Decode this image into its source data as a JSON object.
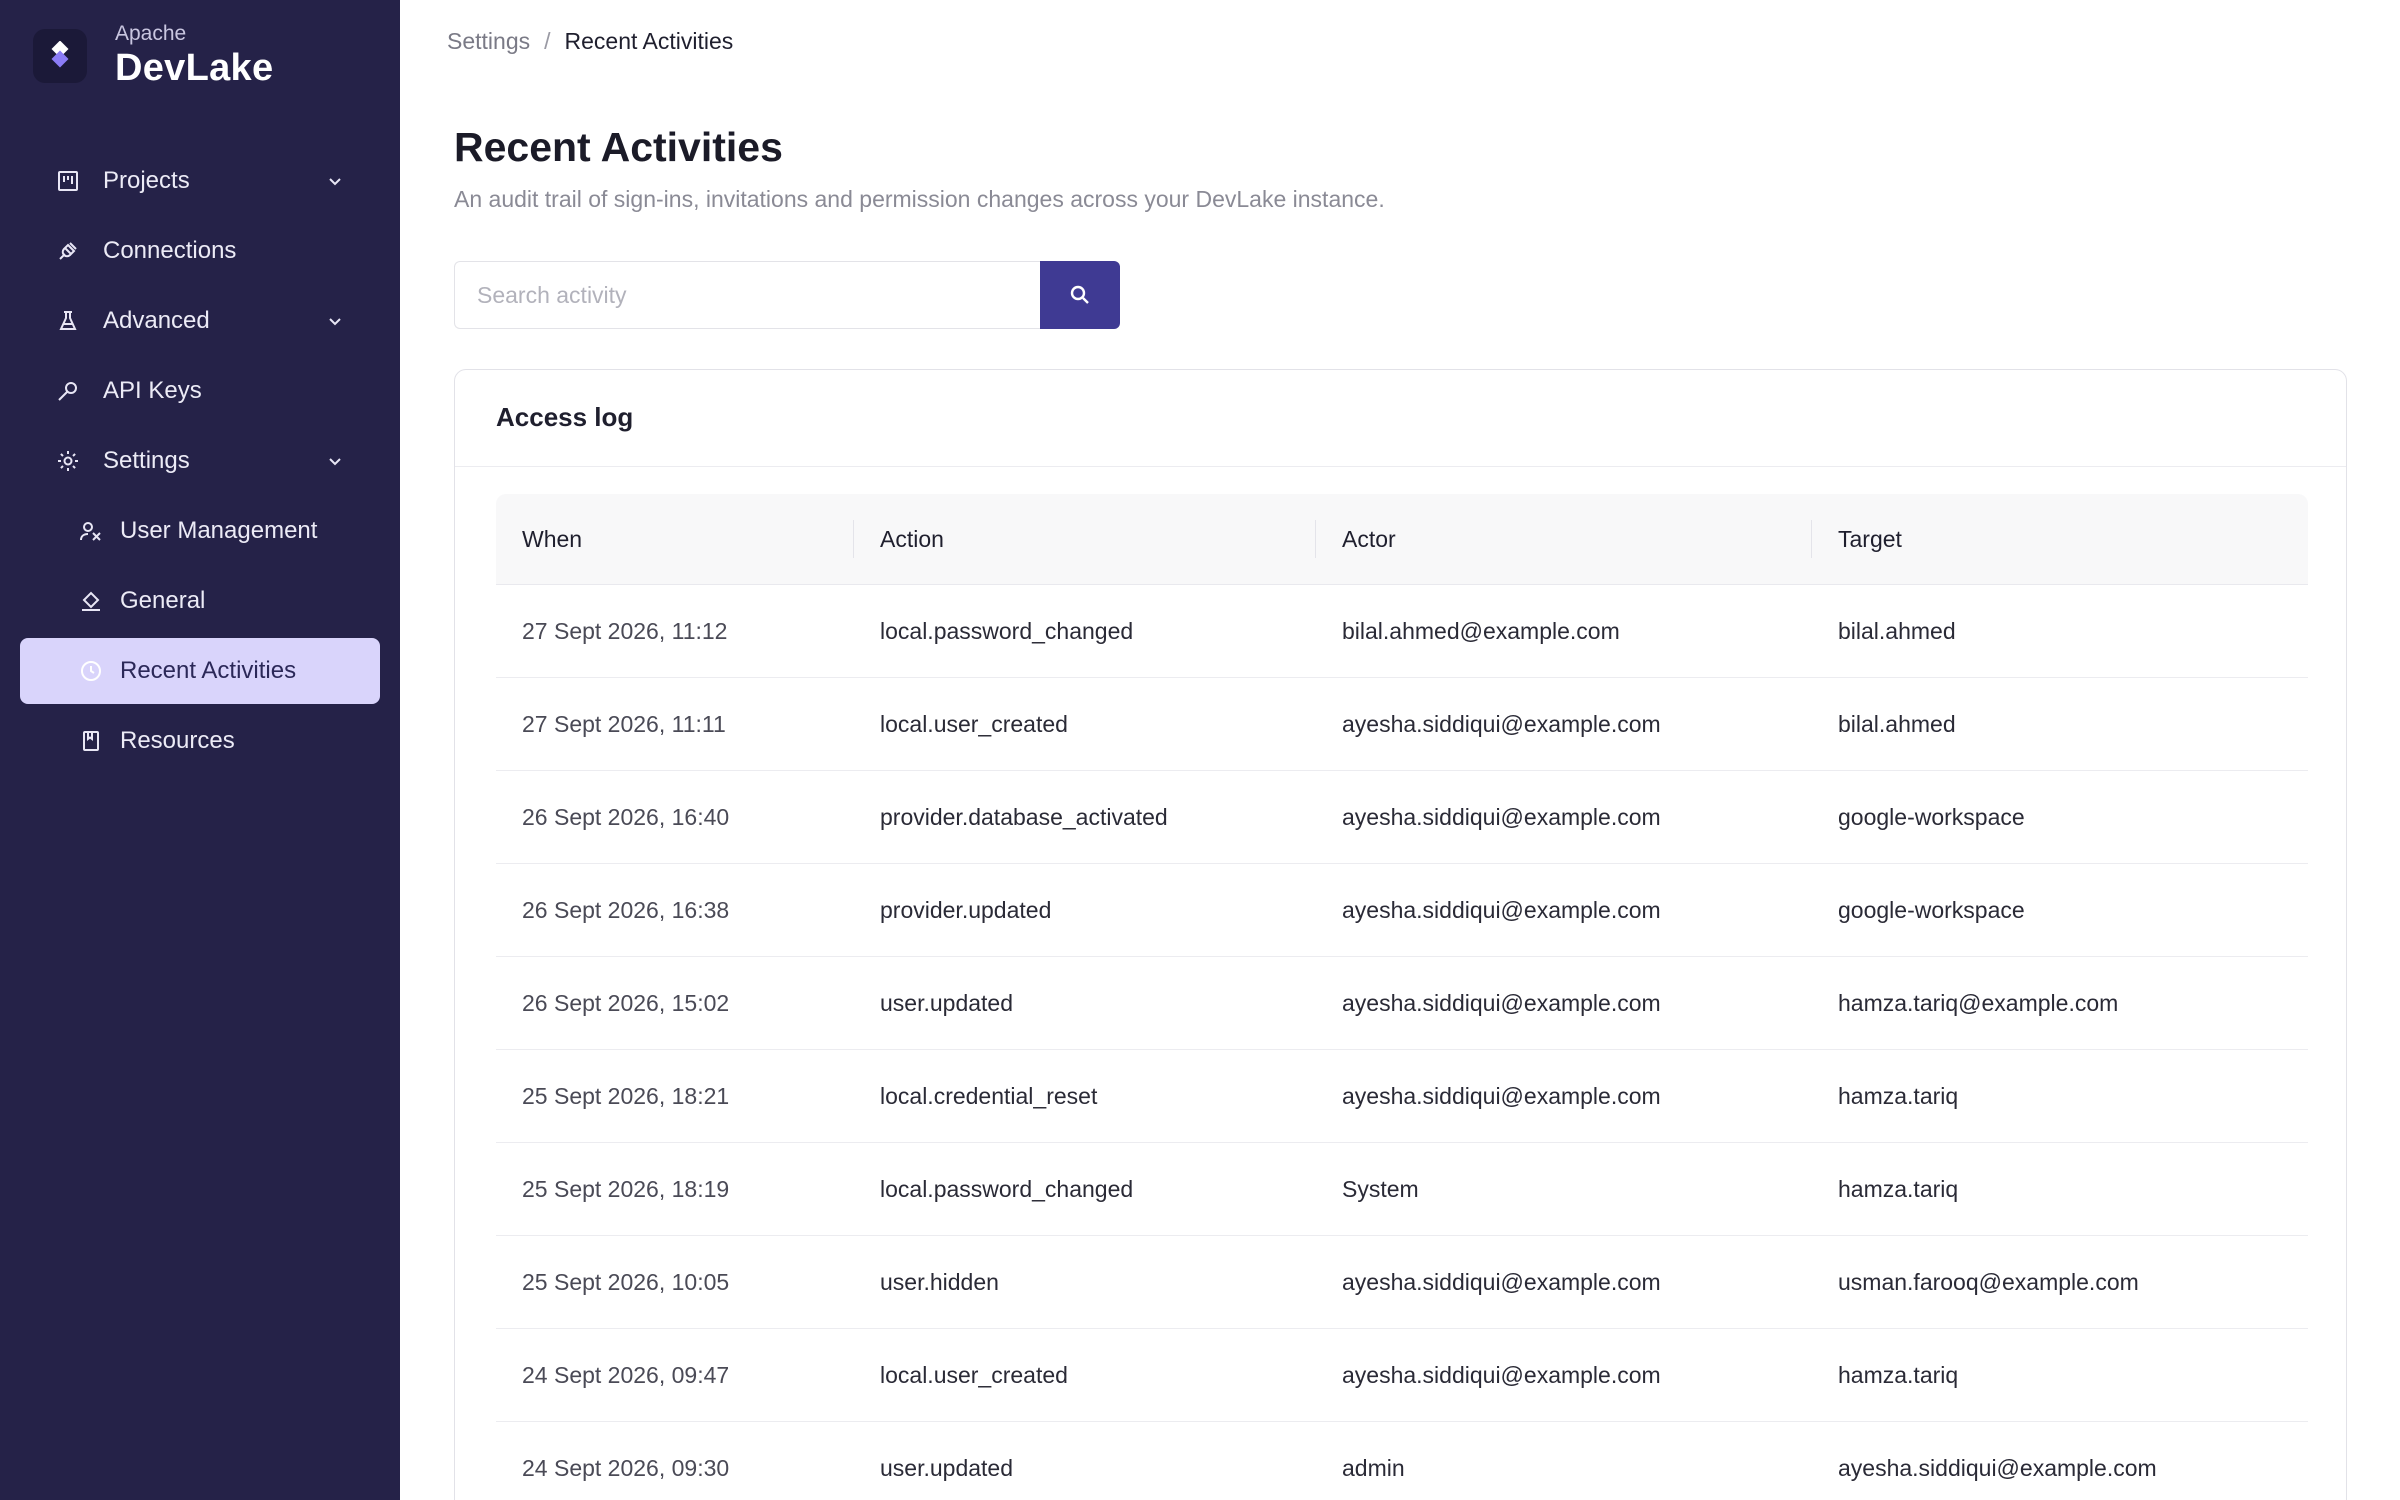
{
  "brand": {
    "sub": "Apache",
    "name": "DevLake"
  },
  "sidebar": {
    "items": [
      {
        "label": "Projects",
        "icon": "kanban-icon",
        "expandable": true
      },
      {
        "label": "Connections",
        "icon": "plug-icon",
        "expandable": false
      },
      {
        "label": "Advanced",
        "icon": "flask-icon",
        "expandable": true
      },
      {
        "label": "API Keys",
        "icon": "key-icon",
        "expandable": false
      },
      {
        "label": "Settings",
        "icon": "gear-icon",
        "expandable": true
      },
      {
        "label": "User Management",
        "icon": "users-icon",
        "sub": true
      },
      {
        "label": "General",
        "icon": "paint-bucket-icon",
        "sub": true
      },
      {
        "label": "Recent Activities",
        "icon": "clock-icon",
        "sub": true,
        "active": true
      },
      {
        "label": "Resources",
        "icon": "book-icon",
        "sub": true
      }
    ]
  },
  "breadcrumb": {
    "parent": "Settings",
    "separator": "/",
    "current": "Recent Activities"
  },
  "page": {
    "title": "Recent Activities",
    "description": "An audit trail of sign-ins, invitations and permission changes across your DevLake instance."
  },
  "search": {
    "placeholder": "Search activity",
    "value": ""
  },
  "card": {
    "title": "Access log"
  },
  "table": {
    "headers": [
      "When",
      "Action",
      "Actor",
      "Target"
    ],
    "rows": [
      [
        "27 Sept 2026, 11:12",
        "local.password_changed",
        "bilal.ahmed@example.com",
        "bilal.ahmed"
      ],
      [
        "27 Sept 2026, 11:11",
        "local.user_created",
        "ayesha.siddiqui@example.com",
        "bilal.ahmed"
      ],
      [
        "26 Sept 2026, 16:40",
        "provider.database_activated",
        "ayesha.siddiqui@example.com",
        "google-workspace"
      ],
      [
        "26 Sept 2026, 16:38",
        "provider.updated",
        "ayesha.siddiqui@example.com",
        "google-workspace"
      ],
      [
        "26 Sept 2026, 15:02",
        "user.updated",
        "ayesha.siddiqui@example.com",
        "hamza.tariq@example.com"
      ],
      [
        "25 Sept 2026, 18:21",
        "local.credential_reset",
        "ayesha.siddiqui@example.com",
        "hamza.tariq"
      ],
      [
        "25 Sept 2026, 18:19",
        "local.password_changed",
        "System",
        "hamza.tariq"
      ],
      [
        "25 Sept 2026, 10:05",
        "user.hidden",
        "ayesha.siddiqui@example.com",
        "usman.farooq@example.com"
      ],
      [
        "24 Sept 2026, 09:47",
        "local.user_created",
        "ayesha.siddiqui@example.com",
        "hamza.tariq"
      ],
      [
        "24 Sept 2026, 09:30",
        "user.updated",
        "admin",
        "ayesha.siddiqui@example.com"
      ]
    ]
  },
  "colors": {
    "sidebar_bg": "#252248",
    "active_bg": "#d9d4fb",
    "accent": "#3f3a93"
  }
}
